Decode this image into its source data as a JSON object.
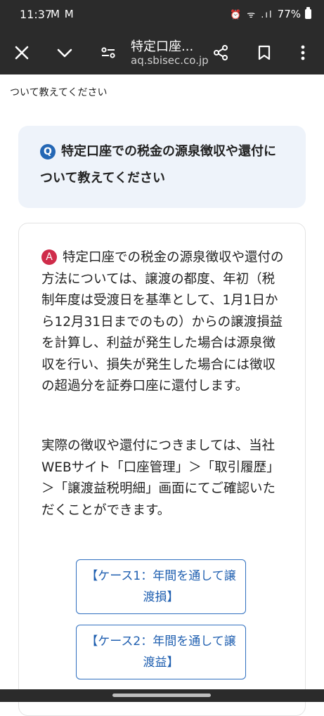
{
  "status_bar": {
    "time": "11:37",
    "mail_indicators": "M M",
    "signal_icons": "⏰ ᯤ .ıl",
    "battery_percent": "77%"
  },
  "toolbar": {
    "title": "特定口座...",
    "url": "aq.sbisec.co.jp",
    "icons": [
      "close-icon",
      "chevron-down-icon",
      "tune-icon",
      "share-icon",
      "bookmark-icon",
      "more-vert-icon"
    ]
  },
  "page": {
    "breadcrumb": "ついて教えてください",
    "question": {
      "badge": "Q",
      "text": "特定口座での税金の源泉徴収や還付について教えてください"
    },
    "answer": {
      "badge": "A",
      "text": "特定口座での税金の源泉徴収や還付の方法については、譲渡の都度、年初（税制年度は受渡日を基準として、1月1日から12月31日までのもの）からの譲渡損益を計算し、利益が発生した場合は源泉徴収を行い、損失が発生した場合には徴収の超過分を証券口座に還付します。",
      "detail": "実際の徴収や還付につきましては、当社WEBサイト「口座管理」＞「取引履歴」＞「譲渡益税明細」画面にてご確認いただくことができます。"
    },
    "cases": [
      {
        "label": "【ケース1：年間を通して譲渡損】"
      },
      {
        "label": "【ケース2：年間を通して譲渡益】"
      }
    ]
  },
  "colors": {
    "chrome": "#2b2b2b",
    "question_bg": "#eef3fa",
    "q_badge": "#2467b5",
    "a_badge": "#cf2c4a",
    "link": "#1f5fb0"
  }
}
